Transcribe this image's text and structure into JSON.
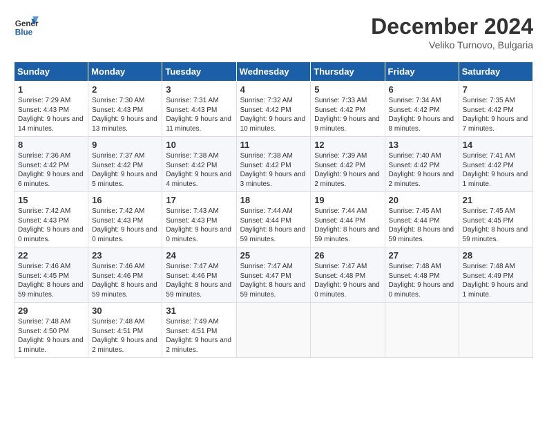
{
  "header": {
    "logo_line1": "General",
    "logo_line2": "Blue",
    "month_title": "December 2024",
    "subtitle": "Veliko Turnovo, Bulgaria"
  },
  "days_of_week": [
    "Sunday",
    "Monday",
    "Tuesday",
    "Wednesday",
    "Thursday",
    "Friday",
    "Saturday"
  ],
  "weeks": [
    [
      {
        "day": "1",
        "sunrise": "Sunrise: 7:29 AM",
        "sunset": "Sunset: 4:43 PM",
        "daylight": "Daylight: 9 hours and 14 minutes."
      },
      {
        "day": "2",
        "sunrise": "Sunrise: 7:30 AM",
        "sunset": "Sunset: 4:43 PM",
        "daylight": "Daylight: 9 hours and 13 minutes."
      },
      {
        "day": "3",
        "sunrise": "Sunrise: 7:31 AM",
        "sunset": "Sunset: 4:43 PM",
        "daylight": "Daylight: 9 hours and 11 minutes."
      },
      {
        "day": "4",
        "sunrise": "Sunrise: 7:32 AM",
        "sunset": "Sunset: 4:42 PM",
        "daylight": "Daylight: 9 hours and 10 minutes."
      },
      {
        "day": "5",
        "sunrise": "Sunrise: 7:33 AM",
        "sunset": "Sunset: 4:42 PM",
        "daylight": "Daylight: 9 hours and 9 minutes."
      },
      {
        "day": "6",
        "sunrise": "Sunrise: 7:34 AM",
        "sunset": "Sunset: 4:42 PM",
        "daylight": "Daylight: 9 hours and 8 minutes."
      },
      {
        "day": "7",
        "sunrise": "Sunrise: 7:35 AM",
        "sunset": "Sunset: 4:42 PM",
        "daylight": "Daylight: 9 hours and 7 minutes."
      }
    ],
    [
      {
        "day": "8",
        "sunrise": "Sunrise: 7:36 AM",
        "sunset": "Sunset: 4:42 PM",
        "daylight": "Daylight: 9 hours and 6 minutes."
      },
      {
        "day": "9",
        "sunrise": "Sunrise: 7:37 AM",
        "sunset": "Sunset: 4:42 PM",
        "daylight": "Daylight: 9 hours and 5 minutes."
      },
      {
        "day": "10",
        "sunrise": "Sunrise: 7:38 AM",
        "sunset": "Sunset: 4:42 PM",
        "daylight": "Daylight: 9 hours and 4 minutes."
      },
      {
        "day": "11",
        "sunrise": "Sunrise: 7:38 AM",
        "sunset": "Sunset: 4:42 PM",
        "daylight": "Daylight: 9 hours and 3 minutes."
      },
      {
        "day": "12",
        "sunrise": "Sunrise: 7:39 AM",
        "sunset": "Sunset: 4:42 PM",
        "daylight": "Daylight: 9 hours and 2 minutes."
      },
      {
        "day": "13",
        "sunrise": "Sunrise: 7:40 AM",
        "sunset": "Sunset: 4:42 PM",
        "daylight": "Daylight: 9 hours and 2 minutes."
      },
      {
        "day": "14",
        "sunrise": "Sunrise: 7:41 AM",
        "sunset": "Sunset: 4:42 PM",
        "daylight": "Daylight: 9 hours and 1 minute."
      }
    ],
    [
      {
        "day": "15",
        "sunrise": "Sunrise: 7:42 AM",
        "sunset": "Sunset: 4:43 PM",
        "daylight": "Daylight: 9 hours and 0 minutes."
      },
      {
        "day": "16",
        "sunrise": "Sunrise: 7:42 AM",
        "sunset": "Sunset: 4:43 PM",
        "daylight": "Daylight: 9 hours and 0 minutes."
      },
      {
        "day": "17",
        "sunrise": "Sunrise: 7:43 AM",
        "sunset": "Sunset: 4:43 PM",
        "daylight": "Daylight: 9 hours and 0 minutes."
      },
      {
        "day": "18",
        "sunrise": "Sunrise: 7:44 AM",
        "sunset": "Sunset: 4:44 PM",
        "daylight": "Daylight: 8 hours and 59 minutes."
      },
      {
        "day": "19",
        "sunrise": "Sunrise: 7:44 AM",
        "sunset": "Sunset: 4:44 PM",
        "daylight": "Daylight: 8 hours and 59 minutes."
      },
      {
        "day": "20",
        "sunrise": "Sunrise: 7:45 AM",
        "sunset": "Sunset: 4:44 PM",
        "daylight": "Daylight: 8 hours and 59 minutes."
      },
      {
        "day": "21",
        "sunrise": "Sunrise: 7:45 AM",
        "sunset": "Sunset: 4:45 PM",
        "daylight": "Daylight: 8 hours and 59 minutes."
      }
    ],
    [
      {
        "day": "22",
        "sunrise": "Sunrise: 7:46 AM",
        "sunset": "Sunset: 4:45 PM",
        "daylight": "Daylight: 8 hours and 59 minutes."
      },
      {
        "day": "23",
        "sunrise": "Sunrise: 7:46 AM",
        "sunset": "Sunset: 4:46 PM",
        "daylight": "Daylight: 8 hours and 59 minutes."
      },
      {
        "day": "24",
        "sunrise": "Sunrise: 7:47 AM",
        "sunset": "Sunset: 4:46 PM",
        "daylight": "Daylight: 8 hours and 59 minutes."
      },
      {
        "day": "25",
        "sunrise": "Sunrise: 7:47 AM",
        "sunset": "Sunset: 4:47 PM",
        "daylight": "Daylight: 8 hours and 59 minutes."
      },
      {
        "day": "26",
        "sunrise": "Sunrise: 7:47 AM",
        "sunset": "Sunset: 4:48 PM",
        "daylight": "Daylight: 9 hours and 0 minutes."
      },
      {
        "day": "27",
        "sunrise": "Sunrise: 7:48 AM",
        "sunset": "Sunset: 4:48 PM",
        "daylight": "Daylight: 9 hours and 0 minutes."
      },
      {
        "day": "28",
        "sunrise": "Sunrise: 7:48 AM",
        "sunset": "Sunset: 4:49 PM",
        "daylight": "Daylight: 9 hours and 1 minute."
      }
    ],
    [
      {
        "day": "29",
        "sunrise": "Sunrise: 7:48 AM",
        "sunset": "Sunset: 4:50 PM",
        "daylight": "Daylight: 9 hours and 1 minute."
      },
      {
        "day": "30",
        "sunrise": "Sunrise: 7:48 AM",
        "sunset": "Sunset: 4:51 PM",
        "daylight": "Daylight: 9 hours and 2 minutes."
      },
      {
        "day": "31",
        "sunrise": "Sunrise: 7:49 AM",
        "sunset": "Sunset: 4:51 PM",
        "daylight": "Daylight: 9 hours and 2 minutes."
      },
      null,
      null,
      null,
      null
    ]
  ]
}
